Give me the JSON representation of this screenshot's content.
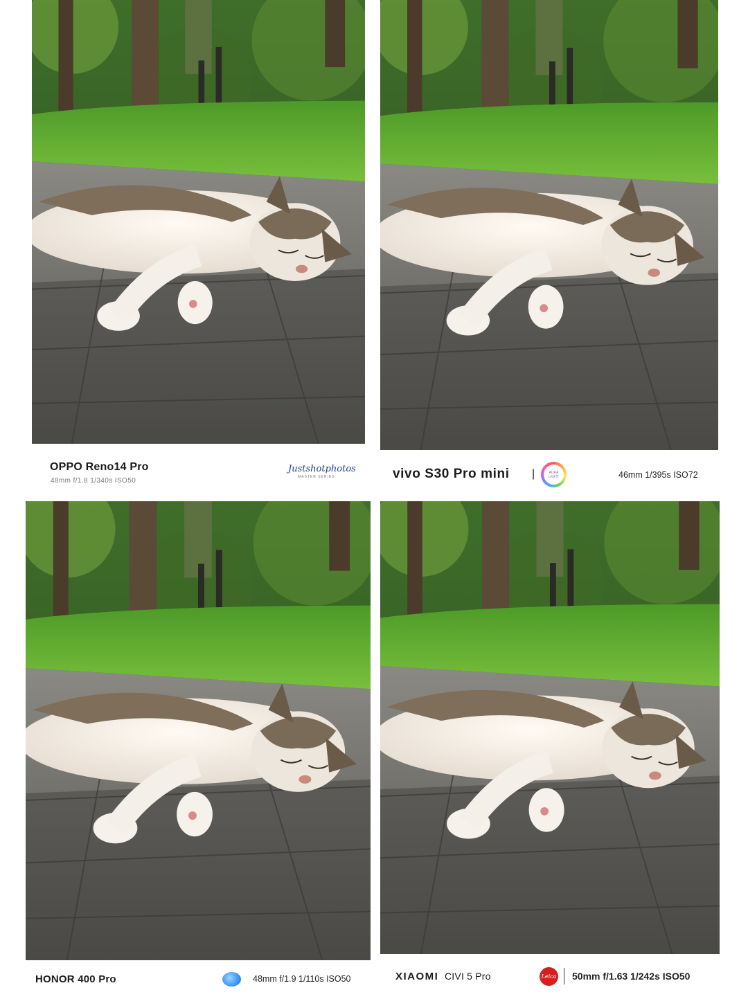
{
  "panels": [
    {
      "model": "OPPO Reno14 Pro",
      "exif": "48mm  f/1.8  1/340s  ISO50",
      "signature": "Justshotphotos",
      "signature_sub": "MASTER SERIES"
    },
    {
      "model": "vivo S30 Pro mini",
      "separator": "|",
      "badge_text": "AURA LIGHT",
      "exif": "46mm  1/395s  ISO72"
    },
    {
      "model": "HONOR 400 Pro",
      "exif": "48mm  f/1.9  1/110s  ISO50"
    },
    {
      "brand": "XIAOMI",
      "model": "CIVI 5 Pro",
      "badge_text": "Leica",
      "exif": "50mm  f/1.63  1/242s  ISO50"
    }
  ],
  "colors": {
    "grass": "#5fa830",
    "foliage_dark": "#2c4a1e",
    "pavement": "#6c6a65",
    "fur_white": "#f4efe8",
    "fur_tabby": "#7e6e5a",
    "leica_red": "#d81e1e",
    "honor_blue": "#2d8cf0"
  },
  "icons": {
    "vivo_badge": "aura-light-ring-icon",
    "honor_badge": "honor-circle-logo-icon",
    "leica_badge": "leica-red-dot-icon"
  }
}
